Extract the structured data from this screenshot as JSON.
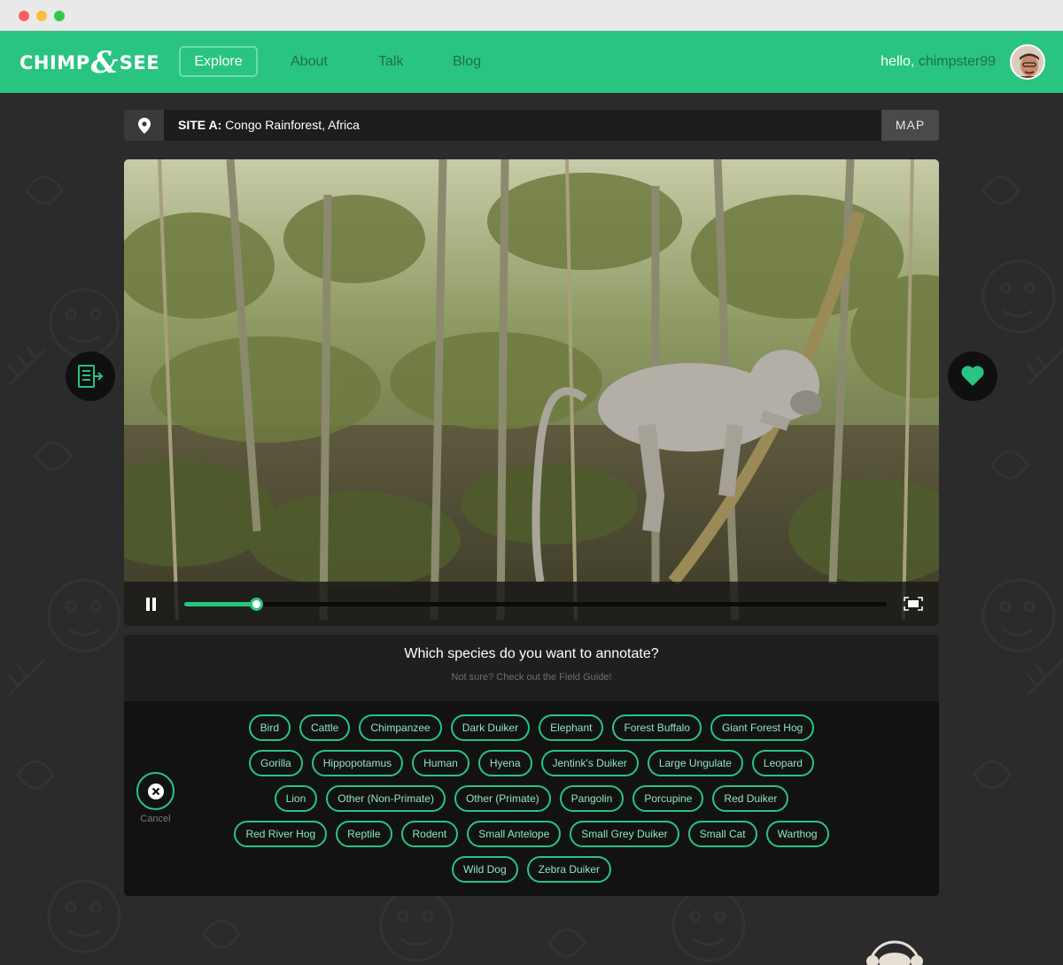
{
  "nav": {
    "logo_left": "CHIMP",
    "logo_amp": "&",
    "logo_right": "SEE",
    "links": [
      {
        "label": "Explore"
      },
      {
        "label": "About"
      },
      {
        "label": "Talk"
      },
      {
        "label": "Blog"
      }
    ],
    "greeting_prefix": "hello,",
    "username": "chimpster99"
  },
  "site": {
    "site_label": "SITE A:",
    "location": "Congo Rainforest, Africa",
    "map_label": "MAP",
    "pin_icon": "map-pin-icon"
  },
  "side_buttons": {
    "left_icon": "field-guide-icon",
    "right_icon": "heart-icon",
    "accent": "#29c481"
  },
  "video": {
    "progress": 0.102,
    "state": "playing"
  },
  "annotate": {
    "question": "Which species do you want to annotate?",
    "hint": "Not sure? Check out the Field Guide!",
    "cancel_label": "Cancel",
    "rows": [
      [
        "Bird",
        "Cattle",
        "Chimpanzee",
        "Dark Duiker",
        "Elephant",
        "Forest Buffalo",
        "Giant Forest Hog"
      ],
      [
        "Gorilla",
        "Hippopotamus",
        "Human",
        "Hyena",
        "Jentink's Duiker",
        "Large Ungulate",
        "Leopard"
      ],
      [
        "Lion",
        "Other (Non-Primate)",
        "Other (Primate)",
        "Pangolin",
        "Porcupine",
        "Red Duiker"
      ],
      [
        "Red River Hog",
        "Reptile",
        "Rodent",
        "Small Antelope",
        "Small Grey Duiker",
        "Small Cat",
        "Warthog"
      ],
      [
        "Wild Dog",
        "Zebra Duiker"
      ]
    ]
  },
  "colors": {
    "brand_green": "#29c481",
    "background": "#2b2b2b"
  }
}
